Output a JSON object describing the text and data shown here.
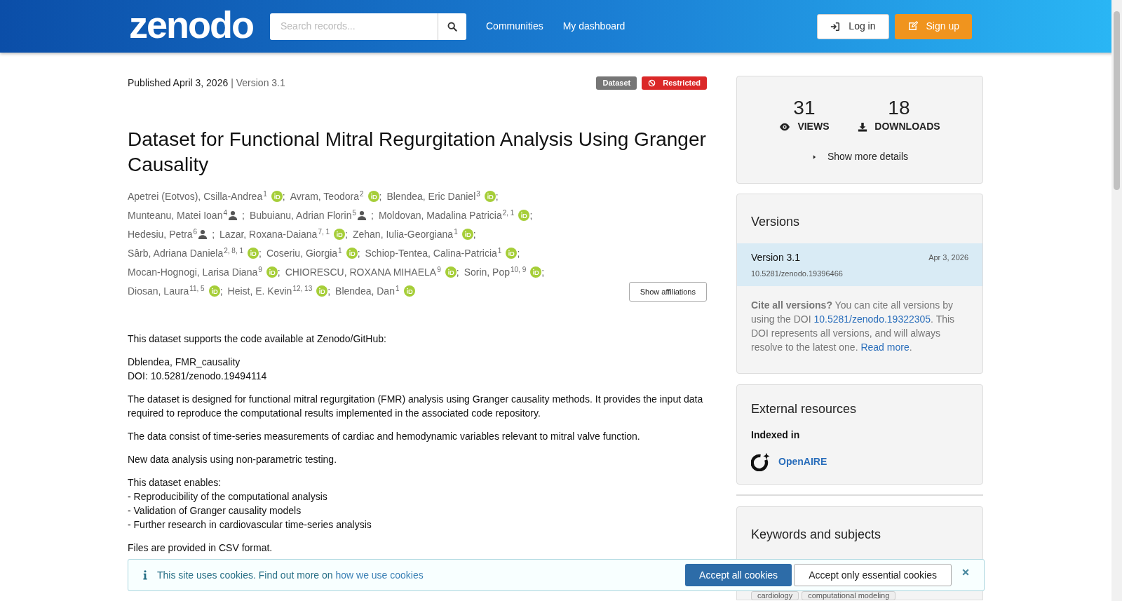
{
  "header": {
    "logo": "zenodo",
    "search": {
      "placeholder": "Search records..."
    },
    "nav": [
      "Communities",
      "My dashboard"
    ],
    "login": "Log in",
    "signup": "Sign up"
  },
  "record": {
    "published": "Published April 3, 2026",
    "version": "| Version 3.1",
    "badges": [
      {
        "label": "Dataset",
        "kind": "type"
      },
      {
        "label": "Restricted",
        "kind": "restricted"
      }
    ],
    "title": "Dataset for Functional Mitral Regurgitation Analysis Using Granger Causality",
    "authors": [
      {
        "name": "Apetrei (Eotvos), Csilla-Andrea",
        "sup": "1",
        "kind": "orcid",
        "sep": ";"
      },
      {
        "name": "Avram, Teodora",
        "sup": "2",
        "kind": "orcid",
        "sep": ";"
      },
      {
        "name": "Blendea, Eric Daniel",
        "sup": "3",
        "kind": "orcid",
        "sep": ";"
      },
      {
        "name": "Munteanu, Matei Ioan",
        "sup": "4",
        "kind": "person",
        "sep": ";"
      },
      {
        "name": "Bubuianu, Adrian Florin",
        "sup": "5",
        "kind": "person",
        "sep": ";"
      },
      {
        "name": "Moldovan, Madalina Patricia",
        "sup": "2, 1",
        "kind": "orcid",
        "sep": ";"
      },
      {
        "name": "Hedesiu, Petra",
        "sup": "6",
        "kind": "person",
        "sep": ";"
      },
      {
        "name": "Lazar, Roxana-Daiana",
        "sup": "7, 1",
        "kind": "orcid",
        "sep": ";"
      },
      {
        "name": "Zehan, Iulia-Georgiana",
        "sup": "1",
        "kind": "orcid",
        "sep": ";"
      },
      {
        "name": "Sârb, Adriana Daniela",
        "sup": "2, 8, 1",
        "kind": "orcid",
        "sep": ";"
      },
      {
        "name": "Coseriu, Giorgia",
        "sup": "1",
        "kind": "orcid",
        "sep": ";"
      },
      {
        "name": "Schiop-Tentea, Calina-Patricia",
        "sup": "1",
        "kind": "orcid",
        "sep": ";"
      },
      {
        "name": "Mocan-Hognogi, Larisa Diana",
        "sup": "9",
        "kind": "orcid",
        "sep": ";"
      },
      {
        "name": "CHIORESCU, ROXANA MIHAELA",
        "sup": "9",
        "kind": "orcid",
        "sep": ";"
      },
      {
        "name": "Sorin, Pop",
        "sup": "10, 9",
        "kind": "orcid",
        "sep": ";"
      },
      {
        "name": "Diosan, Laura",
        "sup": "11, 5",
        "kind": "orcid",
        "sep": ";"
      },
      {
        "name": "Heist, E. Kevin",
        "sup": "12, 13",
        "kind": "orcid",
        "sep": ";"
      },
      {
        "name": "Blendea, Dan",
        "sup": "1",
        "kind": "orcid"
      }
    ],
    "show_affiliations": "Show affiliations",
    "description": [
      [
        "This dataset supports the code available at Zenodo/GitHub:"
      ],
      [
        "Dblendea, FMR_causality",
        "DOI: 10.5281/zenodo.19494114"
      ],
      [
        "The dataset is designed for functional mitral regurgitation (FMR) analysis using Granger causality methods. It provides the input data required to reproduce the computational results implemented in the associated code repository."
      ],
      [
        "The data consist of time-series measurements of cardiac and hemodynamic variables relevant to mitral valve function."
      ],
      [
        "New data analysis using non-parametric testing."
      ],
      [
        "This dataset enables:",
        "- Reproducibility of the computational analysis",
        "- Validation of Granger causality models",
        "- Further research in cardiovascular time-series analysis"
      ],
      [
        "Files are provided in CSV format."
      ]
    ]
  },
  "stats": {
    "views": {
      "count": "31",
      "label": "VIEWS"
    },
    "downloads": {
      "count": "18",
      "label": "DOWNLOADS"
    },
    "more": "Show more details"
  },
  "versions": {
    "title": "Versions",
    "items": [
      {
        "label": "Version 3.1",
        "date": "Apr 3, 2026",
        "doi": "10.5281/zenodo.19396466",
        "selected": true
      }
    ],
    "cite": {
      "lead": "Cite all versions?",
      "text1": "You can cite all versions by using the DOI",
      "doi": "10.5281/zenodo.19322305",
      "text2": ". This DOI represents all versions, and will always resolve to the latest one.",
      "more": "Read more",
      "end": "."
    }
  },
  "external": {
    "title": "External resources",
    "subtitle": "Indexed in",
    "items": [
      "OpenAIRE"
    ]
  },
  "keywords": {
    "title": "Keywords and subjects",
    "tags": [
      "cardiology",
      "computational modeling"
    ]
  },
  "cookies": {
    "text": "This site uses cookies. Find out more on",
    "link": "how we use cookies",
    "accept_all": "Accept all cookies",
    "accept_essential": "Accept only essential cookies"
  }
}
